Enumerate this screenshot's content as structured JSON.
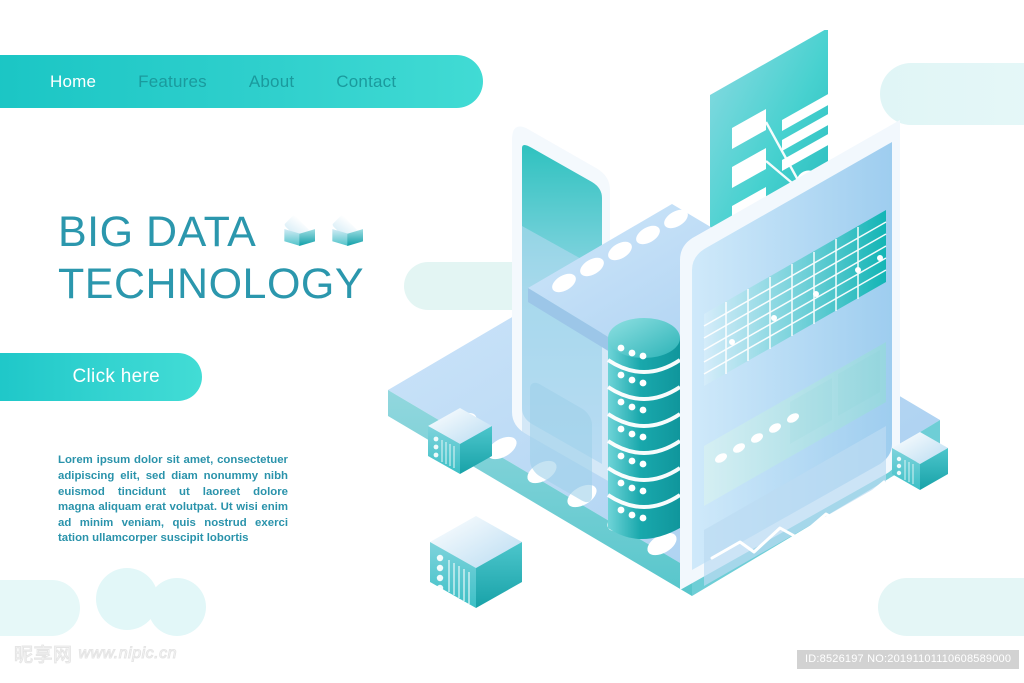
{
  "nav": {
    "items": [
      {
        "label": "Home",
        "active": true
      },
      {
        "label": "Features",
        "active": false
      },
      {
        "label": "About",
        "active": false
      },
      {
        "label": "Contact",
        "active": false
      }
    ]
  },
  "hero": {
    "title_line1": "BIG DATA",
    "title_line2": "TECHNOLOGY",
    "cta_label": "Click here",
    "paragraph": "Lorem ipsum dolor sit amet, consectetuer adipiscing elit, sed diam nonummy nibh euismod tincidunt ut laoreet dolore magna aliquam erat volutpat. Ut wisi enim ad minim veniam, quis nostrud exerci tation ullamcorper suscipit lobortis"
  },
  "footer": {
    "watermark_cn": "昵享网",
    "watermark_url": "www.nipic.cn",
    "id_badge": "ID:8526197 NO:20191101110608589000"
  },
  "colors": {
    "accent_teal": "#1fc9c6",
    "accent_teal_light": "#41dbd4",
    "heading_teal": "#2b97ad",
    "body_teal": "#2a93ab",
    "deco_mint": "#e2f6f7",
    "panel_blue": "#bcdcf5",
    "panel_teal_dark": "#17a6a6",
    "badge_gray": "#d2d2d2"
  },
  "illustration": {
    "name": "big-data-isometric-scene",
    "elements": [
      "floating-data-card",
      "server-wall-panel",
      "database-cylinder-stack",
      "analytics-dashboard-panel",
      "grid-table-graphic",
      "line-chart-graphic",
      "server-box-left",
      "server-box-bottom",
      "server-box-right",
      "platform-base"
    ],
    "database_layers": 7,
    "card_nodes": 3,
    "platform_dots": 6
  }
}
